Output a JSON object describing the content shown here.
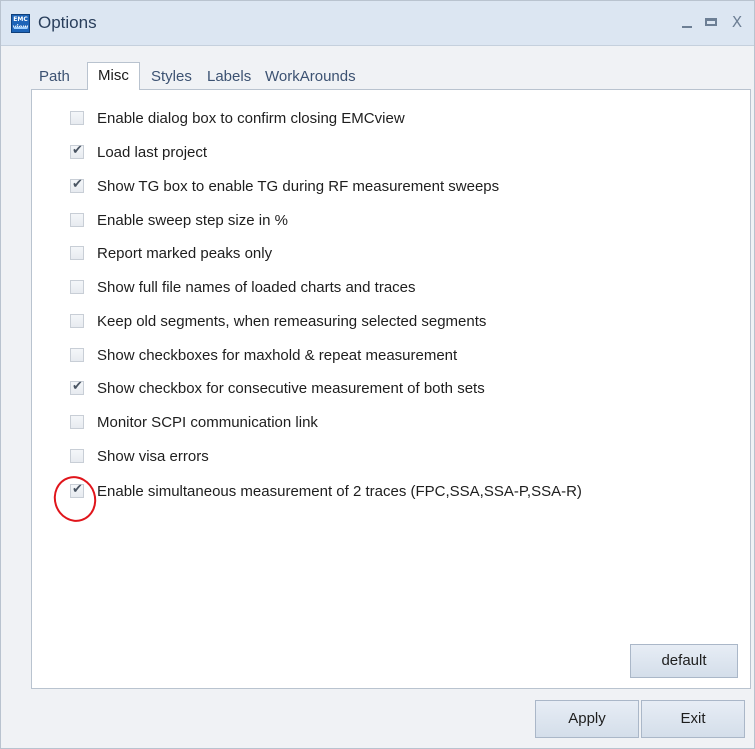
{
  "window": {
    "title": "Options",
    "icon_text_line1": "EMC",
    "icon_text_line2": "view",
    "controls": {
      "minimize": "minimize-icon",
      "maximize": "maximize-icon",
      "close": "X"
    }
  },
  "tabs": [
    {
      "label": "Path",
      "active": false
    },
    {
      "label": "Misc",
      "active": true
    },
    {
      "label": "Styles",
      "active": false
    },
    {
      "label": "Labels",
      "active": false
    },
    {
      "label": "WorkArounds",
      "active": false
    }
  ],
  "options": [
    {
      "label": "Enable dialog box to confirm closing EMCview",
      "checked": false
    },
    {
      "label": "Load last project",
      "checked": true
    },
    {
      "label": "Show TG box to enable TG during RF measurement sweeps",
      "checked": true
    },
    {
      "label": "Enable sweep step size in %",
      "checked": false
    },
    {
      "label": "Report marked peaks only",
      "checked": false
    },
    {
      "label": "Show full file names of loaded charts and traces",
      "checked": false
    },
    {
      "label": "Keep old segments, when remeasuring selected segments",
      "checked": false
    },
    {
      "label": "Show checkboxes for maxhold & repeat measurement",
      "checked": false
    },
    {
      "label": "Show checkbox for consecutive measurement of both sets",
      "checked": true
    },
    {
      "label": "Monitor SCPI communication link",
      "checked": false
    },
    {
      "label": "Show visa errors",
      "checked": false
    },
    {
      "label": "Enable simultaneous measurement of 2 traces (FPC,SSA,SSA-P,SSA-R)",
      "checked": true
    }
  ],
  "buttons": {
    "default": "default",
    "apply": "Apply",
    "exit": "Exit"
  },
  "colors": {
    "annotation_circle": "#e0151b",
    "title_text": "#2a3f5c"
  }
}
